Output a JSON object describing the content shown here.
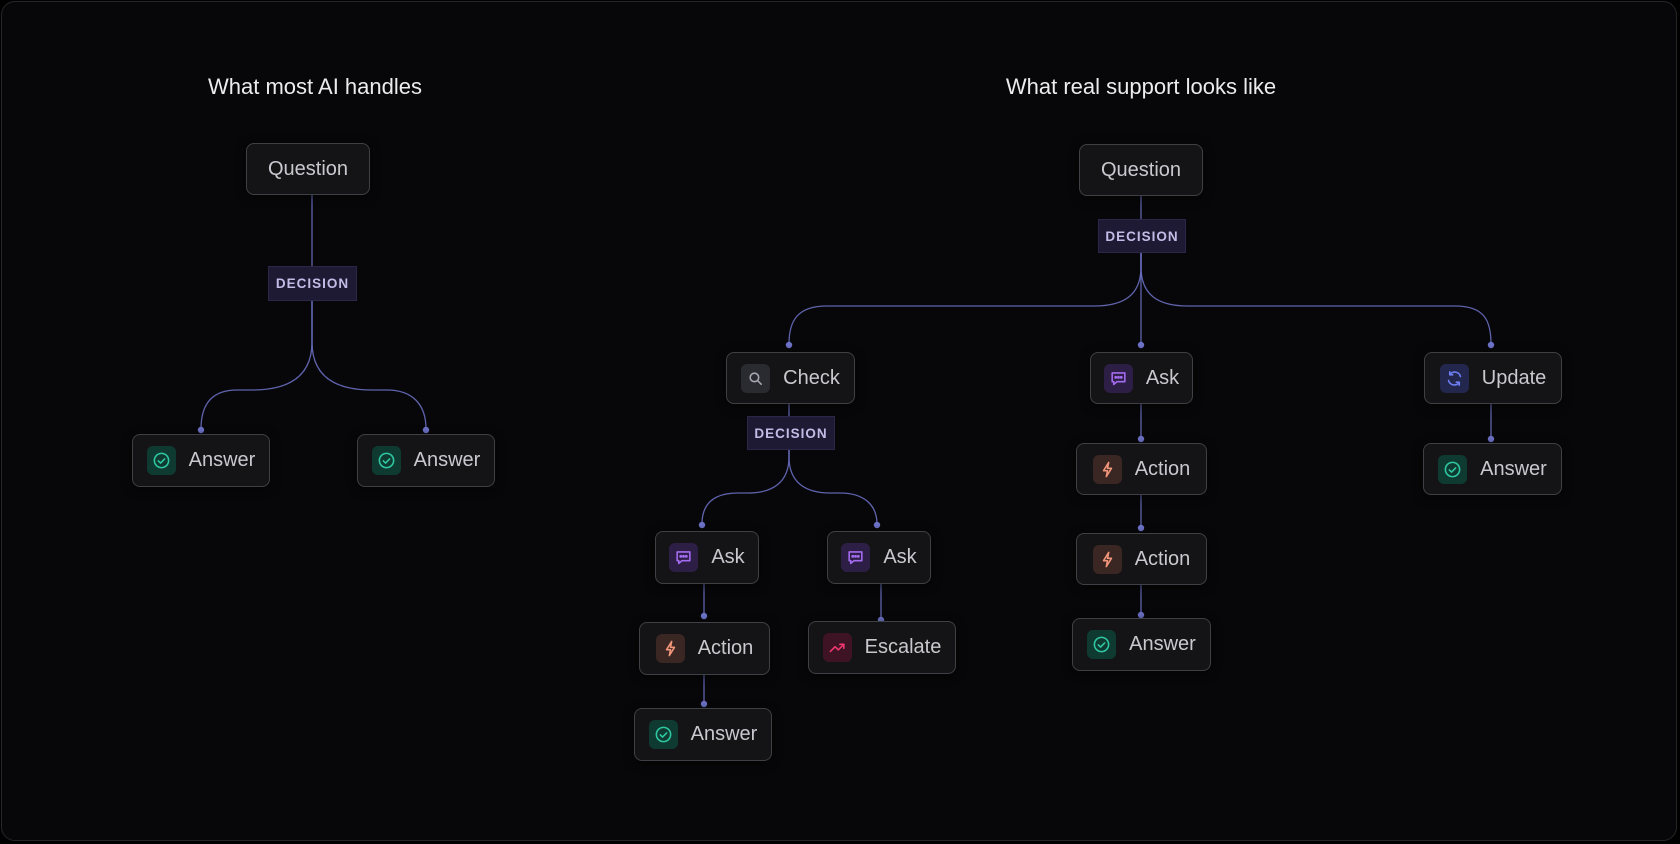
{
  "left": {
    "heading": "What most AI handles",
    "question": "Question",
    "decision": "DECISION",
    "answer_a": "Answer",
    "answer_b": "Answer"
  },
  "right": {
    "heading": "What real support looks like",
    "question": "Question",
    "decision": "DECISION",
    "branch_check": {
      "check": "Check",
      "decision": "DECISION",
      "path_a": {
        "ask": "Ask",
        "action": "Action",
        "answer": "Answer"
      },
      "path_b": {
        "ask": "Ask",
        "escalate": "Escalate"
      }
    },
    "branch_ask": {
      "ask": "Ask",
      "action_1": "Action",
      "action_2": "Action",
      "answer": "Answer"
    },
    "branch_update": {
      "update": "Update",
      "answer": "Answer"
    }
  },
  "icons": {
    "answer": "check-circle-icon",
    "check": "search-icon",
    "ask": "chat-bubble-icon",
    "action": "lightning-bolt-icon",
    "escalate": "trend-up-icon",
    "update": "refresh-icon"
  },
  "colors": {
    "connector": "#6e73c9",
    "answer": "#2fc7a2",
    "ask": "#a46cf0",
    "action": "#f0957a",
    "escalate": "#f0386f",
    "update": "#6d7ef2",
    "check": "#a8a8b3",
    "decision_bg": "#1e1a33"
  }
}
